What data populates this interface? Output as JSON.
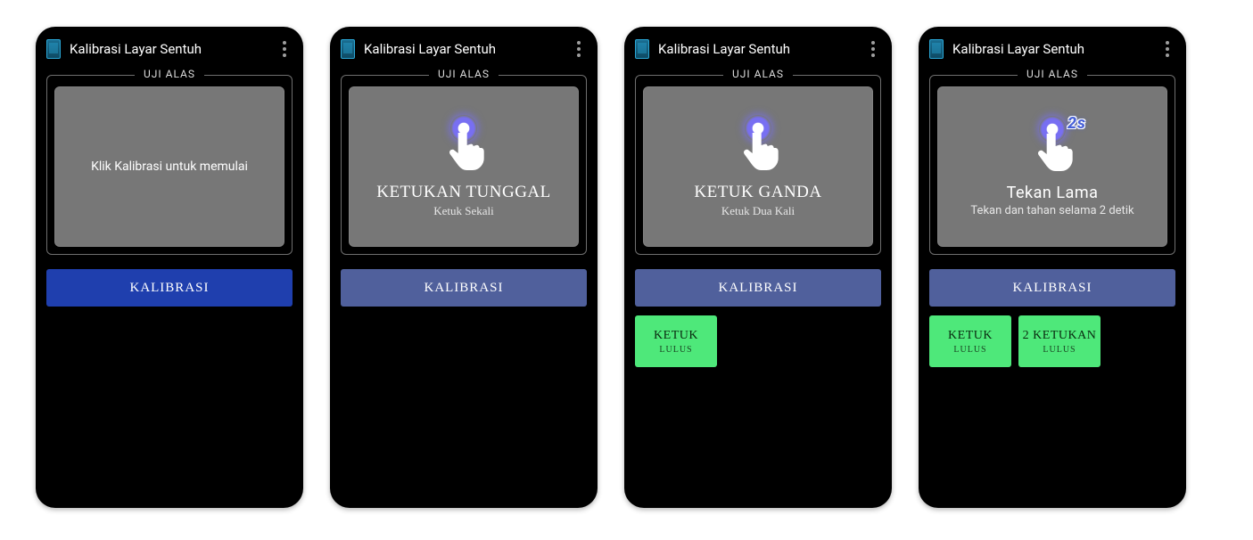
{
  "app_title": "Kalibrasi Layar Sentuh",
  "pad_label": "UJI ALAS",
  "calibrate_label": "KALIBRASI",
  "screens": [
    {
      "mode": "idle",
      "message": "Klik Kalibrasi untuk memulai",
      "button_variant": "bright",
      "results": []
    },
    {
      "mode": "single",
      "title": "KETUKAN TUNGGAL",
      "subtitle": "Ketuk Sekali",
      "button_variant": "muted",
      "results": []
    },
    {
      "mode": "double",
      "title": "KETUK GANDA",
      "subtitle": "Ketuk Dua Kali",
      "button_variant": "muted",
      "results": [
        {
          "title": "KETUK",
          "status": "LULUS"
        }
      ]
    },
    {
      "mode": "long",
      "title": "Tekan Lama",
      "subtitle": "Tekan dan tahan selama 2 detik",
      "badge": "2s",
      "button_variant": "muted",
      "results": [
        {
          "title": "KETUK",
          "status": "LULUS"
        },
        {
          "title": "2 KETUKAN",
          "status": "LULUS"
        }
      ]
    }
  ]
}
